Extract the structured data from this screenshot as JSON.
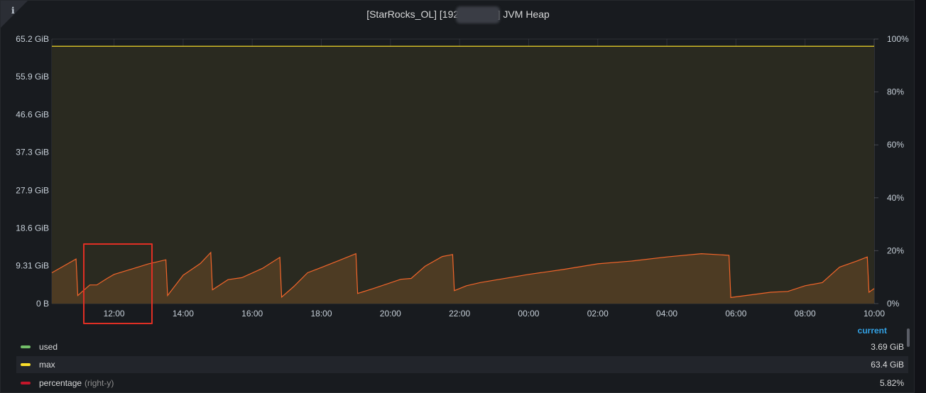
{
  "panel": {
    "title": "[StarRocks_OL] [192.16          3030] JVM Heap",
    "info_icon": "i"
  },
  "chart_data": {
    "type": "area",
    "title": "[StarRocks_OL] [192.16          3030] JVM Heap",
    "x_ticks": [
      "12:00",
      "14:00",
      "16:00",
      "18:00",
      "20:00",
      "22:00",
      "00:00",
      "02:00",
      "04:00",
      "06:00",
      "08:00",
      "10:00"
    ],
    "x_tick_hours": [
      12,
      14,
      16,
      18,
      20,
      22,
      24,
      26,
      28,
      30,
      32,
      34
    ],
    "x_range_hours": [
      10.2,
      34.0
    ],
    "y_left_ticks": [
      "0 B",
      "9.31 GiB",
      "18.6 GiB",
      "27.9 GiB",
      "37.3 GiB",
      "46.6 GiB",
      "55.9 GiB",
      "65.2 GiB"
    ],
    "y_left_tick_values": [
      0,
      9.31,
      18.6,
      27.9,
      37.3,
      46.6,
      55.9,
      65.2
    ],
    "y_left_range": [
      0,
      65.2
    ],
    "y_left_unit": "GiB",
    "y_right_ticks": [
      "0%",
      "20%",
      "40%",
      "60%",
      "80%",
      "100%"
    ],
    "y_right_tick_values": [
      0,
      20,
      40,
      60,
      80,
      100
    ],
    "y_right_range": [
      0,
      100
    ],
    "grid": true,
    "legend_position": "bottom",
    "series": [
      {
        "name": "used",
        "color": "#73bf69",
        "current": "3.69 GiB",
        "x_hours": [
          10.2,
          10.9,
          10.95,
          11.3,
          11.5,
          11.8,
          12.0,
          12.5,
          13.0,
          13.5,
          13.55,
          14.0,
          14.5,
          14.8,
          14.85,
          15.3,
          15.7,
          16.3,
          16.8,
          16.85,
          17.2,
          17.6,
          18.0,
          18.5,
          19.0,
          19.05,
          19.5,
          20.3,
          20.6,
          21.0,
          21.5,
          21.8,
          21.85,
          22.2,
          22.6,
          24.0,
          25.0,
          26.0,
          27.0,
          28.0,
          29.0,
          29.8,
          29.85,
          31.0,
          31.5,
          32.0,
          32.5,
          33.0,
          33.5,
          33.8,
          33.85,
          34.0
        ],
        "y_gib": [
          7.6,
          11.0,
          2.0,
          4.6,
          4.6,
          6.2,
          7.2,
          8.5,
          9.8,
          10.8,
          2.0,
          7.0,
          9.9,
          12.6,
          3.4,
          5.9,
          6.4,
          8.7,
          11.4,
          1.6,
          4.2,
          7.6,
          8.9,
          10.6,
          12.3,
          2.5,
          3.7,
          6.0,
          6.2,
          9.2,
          11.6,
          12.1,
          3.2,
          4.4,
          5.2,
          7.2,
          8.4,
          9.8,
          10.5,
          11.5,
          12.3,
          11.9,
          1.5,
          2.8,
          3.0,
          4.4,
          5.2,
          9.0,
          10.5,
          11.5,
          2.8,
          3.7
        ]
      },
      {
        "name": "max",
        "color": "#fade2a",
        "current": "63.4 GiB",
        "x_hours": [
          10.2,
          34.0
        ],
        "y_gib": [
          63.4,
          63.4
        ]
      },
      {
        "name": "percentage",
        "suffix": "(right-y)",
        "color": "#c4162a",
        "current": "5.82%",
        "x_hours": [
          10.2,
          34.0
        ],
        "y_percent": [
          12.0,
          5.82
        ]
      }
    ]
  },
  "legend": {
    "header": "current",
    "rows": [
      {
        "label": "used",
        "suffix": "",
        "value": "3.69 GiB",
        "color": "#73bf69"
      },
      {
        "label": "max",
        "suffix": "",
        "value": "63.4 GiB",
        "color": "#fade2a"
      },
      {
        "label": "percentage",
        "suffix": "(right-y)",
        "value": "5.82%",
        "color": "#c4162a"
      }
    ]
  },
  "annotation": {
    "color": "#e02f24"
  }
}
